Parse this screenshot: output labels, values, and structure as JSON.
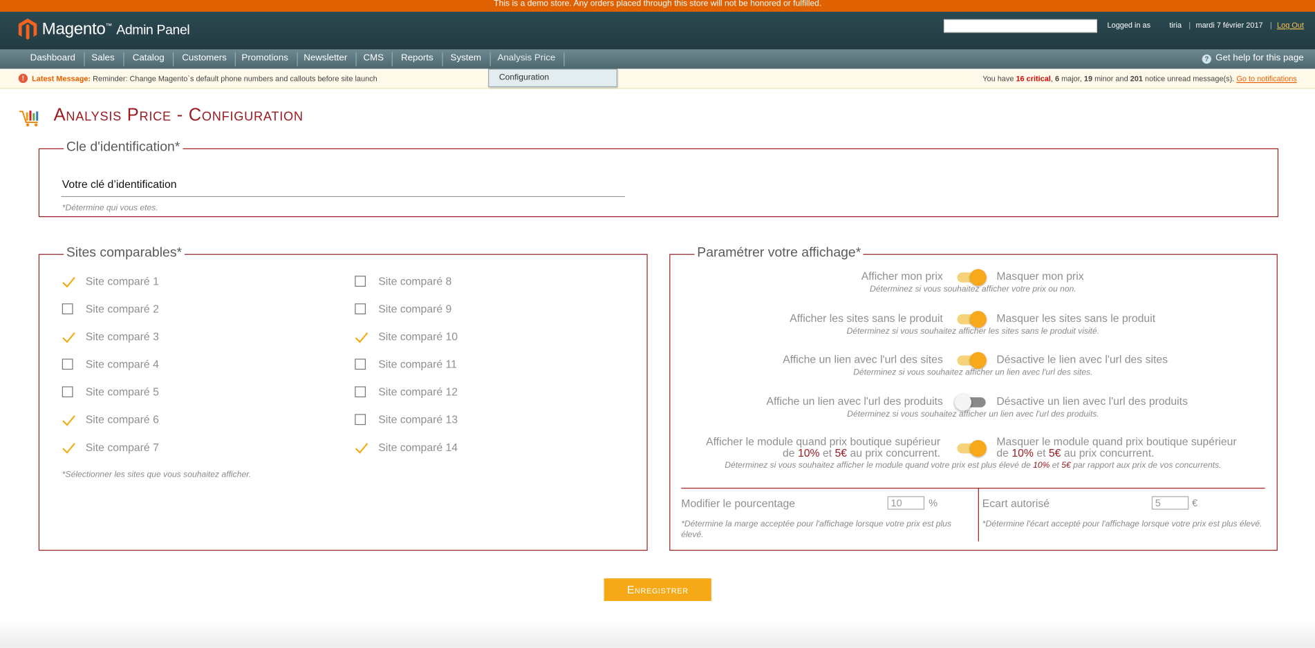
{
  "demo_notice": "This is a demo store. Any orders placed through this store will not be honored or fulfilled.",
  "header": {
    "logo_brand": "Magento",
    "logo_suffix": "Admin Panel",
    "logged_in_label": "Logged in as",
    "username": "tiria",
    "date": "mardi 7 février 2017",
    "logout": "Log Out"
  },
  "nav": {
    "items": [
      "Dashboard",
      "Sales",
      "Catalog",
      "Customers",
      "Promotions",
      "Newsletter",
      "CMS",
      "Reports",
      "System",
      "Analysis Price"
    ],
    "help": "Get help for this page",
    "submenu_item": "Configuration"
  },
  "message": {
    "label": "Latest Message",
    "text": "Reminder: Change Magento`s default phone numbers and callouts before site launch",
    "you_have": "You have",
    "critical_count": "16 critical",
    "major_count": "6",
    "major_label": "major,",
    "minor_count": "19",
    "minor_label": "minor and",
    "notice_count": "201",
    "notice_label": "notice unread message(s).",
    "link": "Go to notifications"
  },
  "page_title": "Analysis Price - Configuration",
  "id_section": {
    "legend": "Cle d'identification*",
    "value": "Votre clé d’identification",
    "hint": "*Détermine qui vous etes."
  },
  "sites_section": {
    "legend": "Sites comparables*",
    "sites": [
      {
        "label": "Site comparé 1",
        "checked": true
      },
      {
        "label": "Site comparé 2",
        "checked": false
      },
      {
        "label": "Site comparé 3",
        "checked": true
      },
      {
        "label": "Site comparé 4",
        "checked": false
      },
      {
        "label": "Site comparé 5",
        "checked": false
      },
      {
        "label": "Site comparé 6",
        "checked": true
      },
      {
        "label": "Site comparé 7",
        "checked": true
      },
      {
        "label": "Site comparé 8",
        "checked": false
      },
      {
        "label": "Site comparé 9",
        "checked": false
      },
      {
        "label": "Site comparé 10",
        "checked": true
      },
      {
        "label": "Site comparé 11",
        "checked": false
      },
      {
        "label": "Site comparé 12",
        "checked": false
      },
      {
        "label": "Site comparé 13",
        "checked": false
      },
      {
        "label": "Site comparé 14",
        "checked": true
      }
    ],
    "hint": "*Sélectionner les sites que vous souhaitez afficher."
  },
  "display_section": {
    "legend": "Paramétrer votre affichage*",
    "settings": [
      {
        "left": "Afficher mon prix",
        "right": "Masquer mon prix",
        "desc": "Déterminez si vous souhaitez afficher votre prix ou non.",
        "on": true
      },
      {
        "left": "Afficher les sites sans le produit",
        "right": "Masquer les sites sans le produit",
        "desc": "Déterminez si vous souhaitez afficher les sites sans le produit visité.",
        "on": true
      },
      {
        "left": "Affiche un lien avec l'url des sites",
        "right": "Désactive le lien avec l'url des sites",
        "desc": "Déterminez si vous souhaitez afficher un lien avec l'url des sites.",
        "on": true
      },
      {
        "left": "Affiche un lien avec l'url des produits",
        "right": "Désactive un lien avec l'url des produits",
        "desc": "Déterminez si vous souhaitez afficher un lien avec l'url des produits.",
        "on": false
      }
    ],
    "module": {
      "left_line1": "Afficher le module quand prix boutique supérieur",
      "left_de": "de",
      "pct": "10%",
      "et": "et",
      "eur": "5€",
      "left_end": "au prix concurrent.",
      "right_line1": "Masquer le module quand prix boutique supérieur",
      "right_de": "de",
      "right_end": "au prix concurrent.",
      "desc_start": "Déterminez si vous souhaitez afficher le module quand votre prix est plus élevé de",
      "desc_end": "par rapport aux prix de vos concurrents.",
      "on": true
    },
    "percent_field": {
      "label": "Modifier le pourcentage",
      "value": "10",
      "unit": "%",
      "hint": "*Détermine la marge acceptée pour l'affichage lorsque votre prix est plus élevé."
    },
    "gap_field": {
      "label": "Ecart autorisé",
      "value": "5",
      "unit": "€",
      "hint": "*Détermine l'écart accepté pour l'affichage lorsque votre prix est plus élevé."
    }
  },
  "save_button": "Enregistrer",
  "colors": {
    "accent": "#9a1c21",
    "orange": "#f6a917",
    "header": "#2b4951"
  }
}
